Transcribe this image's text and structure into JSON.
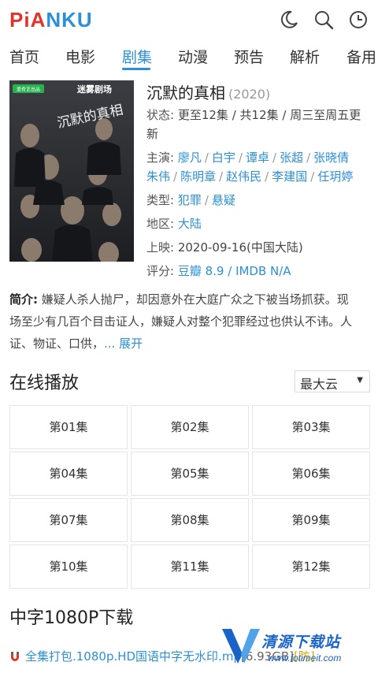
{
  "app": {
    "logo": {
      "pi": "PiA",
      "nku": "NKU"
    },
    "icons": [
      "moon-icon",
      "search-icon",
      "clock-icon"
    ],
    "colors": {
      "accent": "#2c8fd8",
      "logo_red": "#e0342b"
    }
  },
  "nav": {
    "items": [
      "首页",
      "电影",
      "剧集",
      "动漫",
      "预告",
      "解析",
      "备用"
    ],
    "active": "剧集"
  },
  "movie": {
    "title": "沉默的真相",
    "year": "(2020)",
    "poster": {
      "badge": "爱奇艺出品",
      "studio": "迷雾剧场",
      "title": "沉默的真相"
    },
    "status_label": "状态:",
    "status_line1": "更至12集 / 共12集 / 周三至周五更",
    "status_line2": "新",
    "cast_label": "主演:",
    "cast_row1": [
      "廖凡",
      "白宇",
      "谭卓",
      "张超",
      "张晓倩"
    ],
    "cast_row2": [
      "朱伟",
      "陈明章",
      "赵伟民",
      "李建国",
      "任玥婷"
    ],
    "genre_label": "类型:",
    "genres": [
      "犯罪",
      "悬疑"
    ],
    "region_label": "地区:",
    "region": "大陆",
    "release_label": "上映:",
    "release": "2020-09-16(中国大陆)",
    "rating_label": "评分:",
    "rating_douban": "豆瓣 8.9",
    "rating_sep": " / ",
    "rating_imdb": "IMDB N/A"
  },
  "synopsis": {
    "label": "简介:",
    "text1": "嫌疑人杀人抛尸，却因意外在大庭广众之下被当场抓获。现",
    "text2": "场至少有几百个目击证人，嫌疑人对整个犯罪经过也供认不讳。人",
    "text3": "证、物证、口供，",
    "more": "... 展开"
  },
  "play": {
    "title": "在线播放",
    "source": "最大云",
    "episodes": [
      "第01集",
      "第02集",
      "第03集",
      "第04集",
      "第05集",
      "第06集",
      "第07集",
      "第08集",
      "第09集",
      "第10集",
      "第11集",
      "第12集"
    ]
  },
  "download": {
    "title": "中字1080P下载",
    "file": "全集打包.1080p.HD国语中字无水印.mp",
    "size": "[6.93GB]",
    "tag": "[防]"
  },
  "watermark": {
    "title": "清源下载站",
    "url": "www.fotimeit.com"
  }
}
